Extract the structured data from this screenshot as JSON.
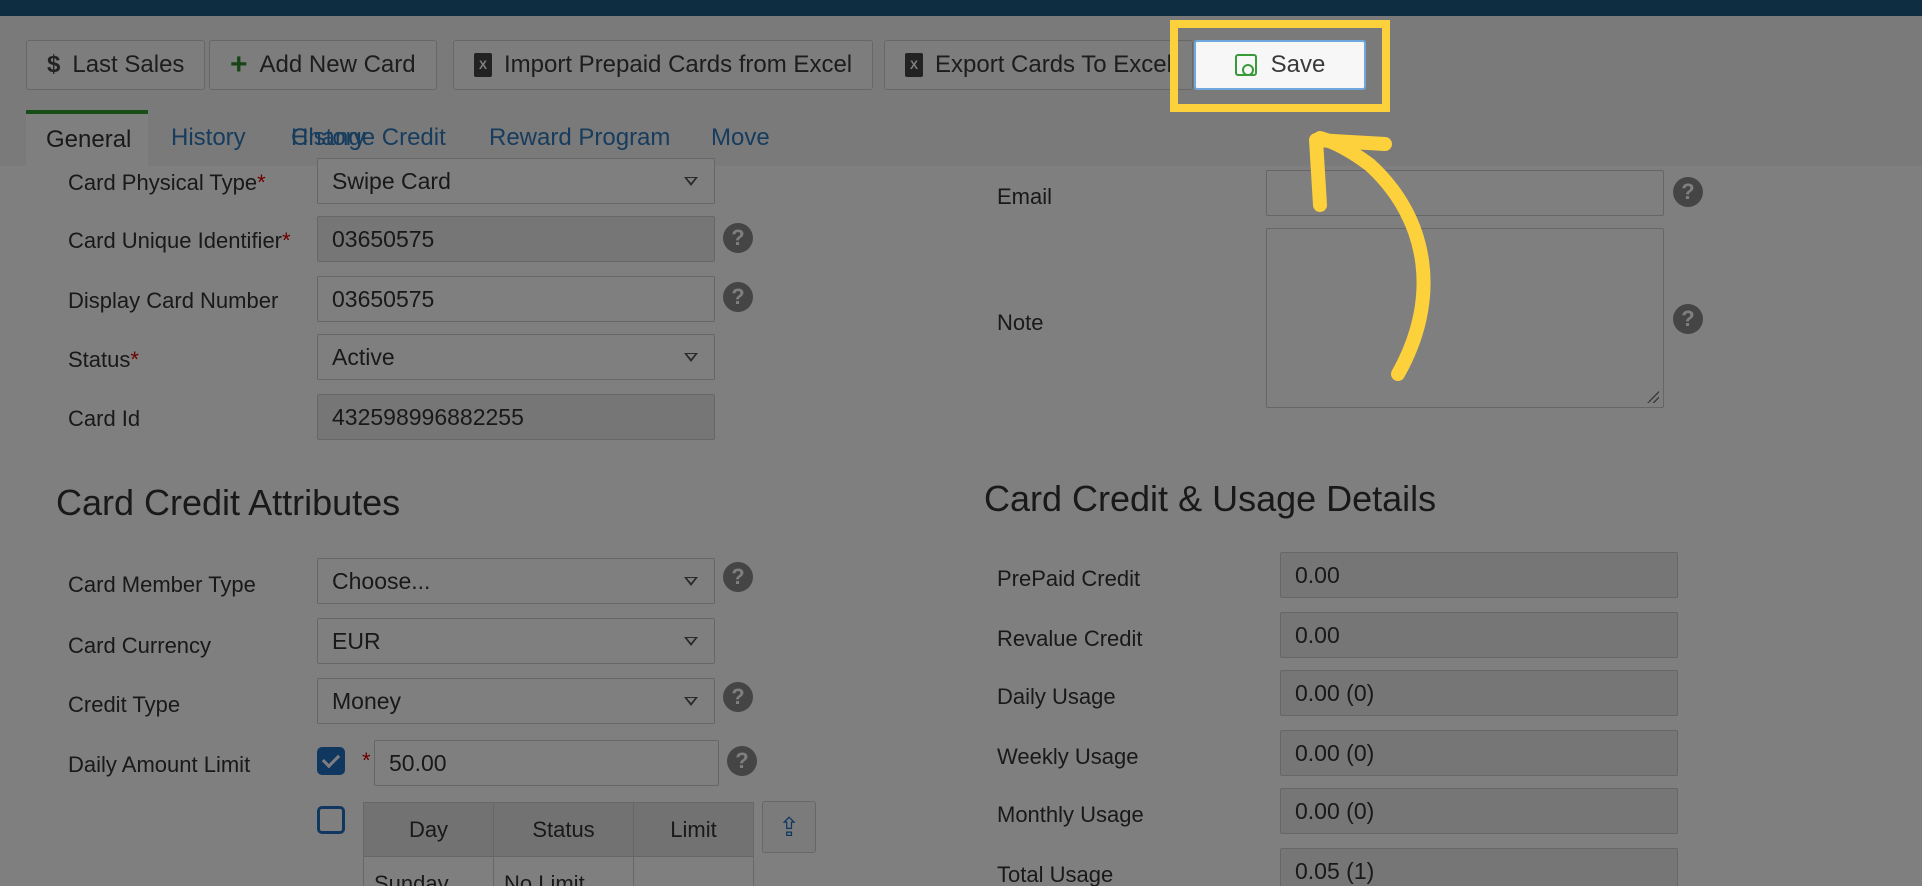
{
  "toolbar": {
    "last_sales": "Last Sales",
    "add_new_card": "Add New Card",
    "import_prepaid": "Import Prepaid Cards from Excel",
    "export_cards": "Export Cards To Excel",
    "save": "Save"
  },
  "tabs": [
    "General",
    "History",
    "Change Credit",
    "Reward Program",
    "Move"
  ],
  "card_info": {
    "physical_type_label": "Card Physical Type",
    "physical_type_value": "Swipe Card",
    "unique_id_label": "Card Unique Identifier",
    "unique_id_value": "03650575",
    "display_number_label": "Display Card Number",
    "display_number_value": "03650575",
    "status_label": "Status",
    "status_value": "Active",
    "card_id_label": "Card Id",
    "card_id_value": "432598996882255",
    "email_label": "Email",
    "email_value": "",
    "note_label": "Note",
    "note_value": ""
  },
  "credit_attributes": {
    "title": "Card Credit Attributes",
    "member_type_label": "Card Member Type",
    "member_type_value": "Choose...",
    "currency_label": "Card Currency",
    "currency_value": "EUR",
    "credit_type_label": "Credit Type",
    "credit_type_value": "Money",
    "daily_limit_label": "Daily Amount Limit",
    "daily_limit_value": "50.00",
    "daily_limit_checked": true,
    "weekly_table_checked": false,
    "table_headers": [
      "Day",
      "Status",
      "Limit"
    ],
    "table_rows": [
      [
        "Sunday",
        "No Limit",
        ""
      ]
    ]
  },
  "usage_details": {
    "title": "Card Credit & Usage Details",
    "prepaid_label": "PrePaid Credit",
    "prepaid_value": "0.00",
    "revalue_label": "Revalue Credit",
    "revalue_value": "0.00",
    "daily_label": "Daily Usage",
    "daily_value": "0.00 (0)",
    "weekly_label": "Weekly Usage",
    "weekly_value": "0.00 (0)",
    "monthly_label": "Monthly Usage",
    "monthly_value": "0.00 (0)",
    "total_label": "Total Usage",
    "total_value": "0.05 (1)"
  },
  "help_glyph": "?",
  "colors": {
    "highlight": "#fdd13b",
    "accent_blue": "#1f6fbf",
    "tab_active": "#2e9b2e",
    "topbar": "#1f5a83"
  }
}
